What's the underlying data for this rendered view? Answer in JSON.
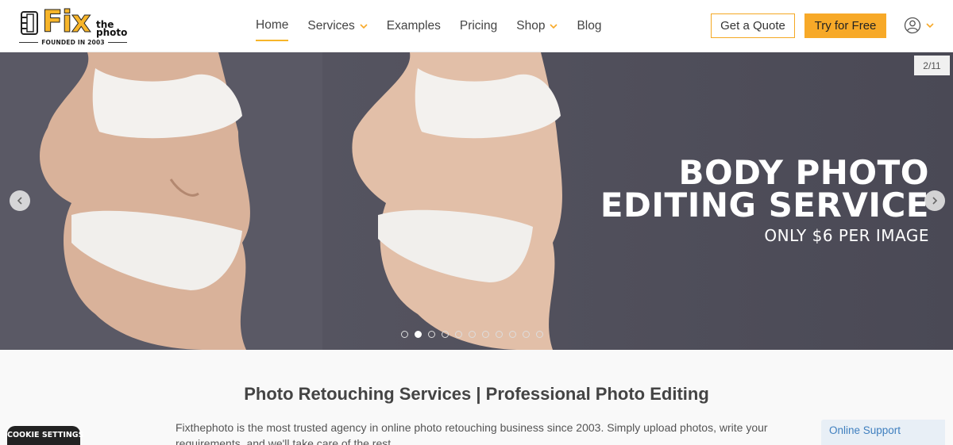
{
  "header": {
    "logo": {
      "fix": "Fix",
      "the": "the",
      "photo": "photo",
      "founded": "FOUNDED IN 2003"
    },
    "nav": [
      {
        "label": "Home",
        "active": true,
        "dropdown": false
      },
      {
        "label": "Services",
        "active": false,
        "dropdown": true
      },
      {
        "label": "Examples",
        "active": false,
        "dropdown": false
      },
      {
        "label": "Pricing",
        "active": false,
        "dropdown": false
      },
      {
        "label": "Shop",
        "active": false,
        "dropdown": true
      },
      {
        "label": "Blog",
        "active": false,
        "dropdown": false
      }
    ],
    "quote_button": "Get a Quote",
    "try_button": "Try for Free",
    "account_icon": "user-circle-icon"
  },
  "hero": {
    "counter": "2/11",
    "title_line1": "BODY PHOTO",
    "title_line2": "EDITING SERVICE",
    "subtitle": "ONLY $6 PER IMAGE",
    "slide_count": 11,
    "active_slide": 2
  },
  "content": {
    "title": "Photo Retouching Services | Professional Photo Editing",
    "text": "Fixthephoto is the most trusted agency in online photo retouching business since 2003. Simply upload photos, write your requirements, and we'll take care of the rest."
  },
  "cookie_button": "COOKIE SETTINGS",
  "support_label": "Online Support",
  "colors": {
    "accent": "#f7a928",
    "hero_bg": "#4d4c56",
    "support_text": "#3f7fbf"
  }
}
